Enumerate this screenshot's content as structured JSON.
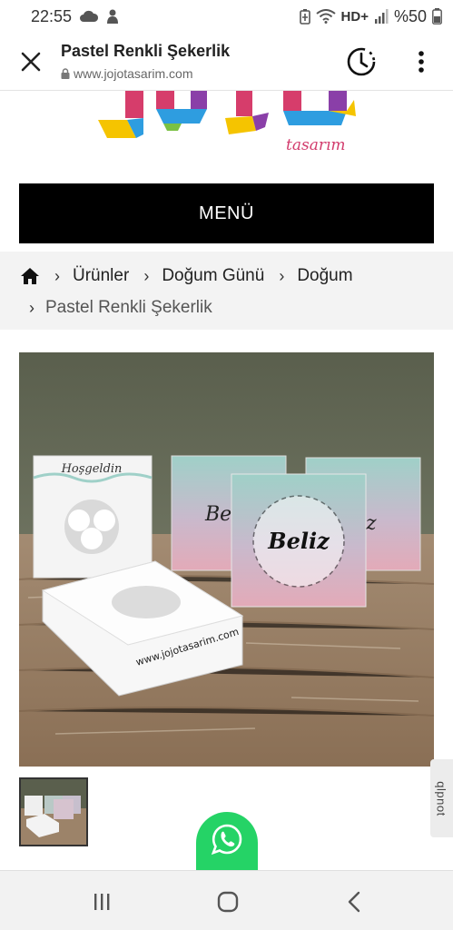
{
  "status_bar": {
    "time": "22:55",
    "network": "HD+",
    "battery": "%50"
  },
  "browser": {
    "page_title": "Pastel Renkli Şekerlik",
    "url": "www.jojotasarim.com"
  },
  "site": {
    "logo_tagline": "tasarım",
    "menu_label": "MENÜ"
  },
  "breadcrumb": {
    "items": [
      "Ürünler",
      "Doğum Günü",
      "Doğum"
    ],
    "current": "Pastel Renkli Şekerlik"
  },
  "product_image": {
    "box_text_front": "Beliz",
    "box_text_welcome": "Hoşgeldin",
    "box_text_url": "www.jojotasarim.com"
  },
  "feedback_tab": {
    "label": "qlpnot"
  },
  "colors": {
    "menu_bg": "#000000",
    "whatsapp": "#25d366",
    "logo_pink": "#d23c6d",
    "breadcrumb_bg": "#f3f3f3"
  }
}
